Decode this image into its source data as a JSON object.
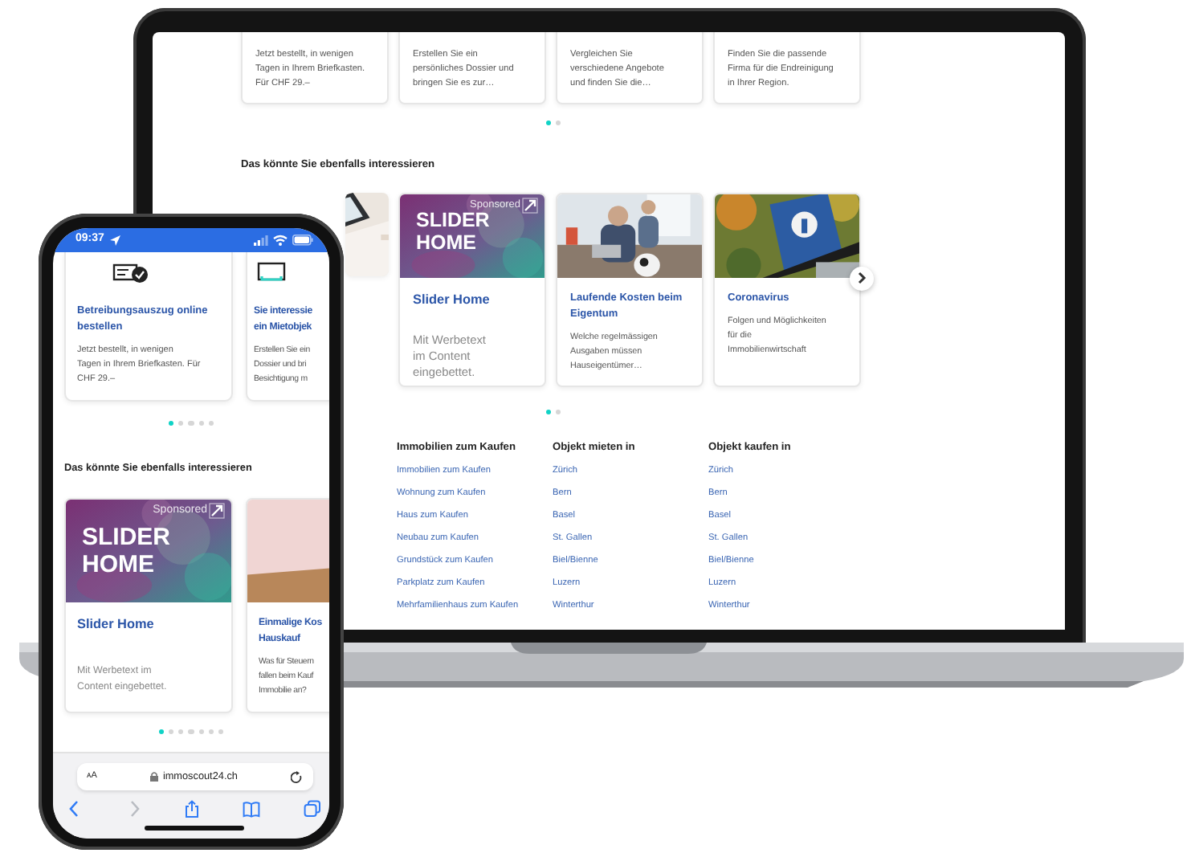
{
  "laptop": {
    "cards": [
      {
        "body": "Jetzt bestellt, in wenigen\nTagen in Ihrem Briefkasten.\nFür CHF 29.–"
      },
      {
        "body": "Erstellen Sie ein\npersönliches Dossier und\nbringen Sie es zur…"
      },
      {
        "body": "Vergleichen Sie\nverschiedene Angebote\nund finden Sie die…"
      },
      {
        "body": "Finden Sie die passende\nFirma für die Endreinigung\nin Ihrer Region."
      }
    ],
    "card_dots": [
      {
        "selected": true
      },
      {
        "selected": false
      }
    ],
    "section_title": "Das könnte Sie ebenfalls interessieren",
    "teasers": [
      {
        "kind": "image_only"
      },
      {
        "kind": "sponsored",
        "badge": "Sponsored",
        "banner": "SLIDER\nHOME",
        "title": "Slider Home",
        "body": "Mit Werbetext\nim Content\neingebettet."
      },
      {
        "kind": "article",
        "title": "Laufende Kosten beim\nEigentum",
        "body": "Welche regelmässigen\nAusgaben müssen\nHauseigentümer…"
      },
      {
        "kind": "article",
        "title": "Coronavirus",
        "body": "Folgen und Möglichkeiten\nfür die\nImmobilienwirtschaft"
      }
    ],
    "teaser_dots": [
      {
        "selected": true
      },
      {
        "selected": false
      }
    ],
    "link_columns": [
      {
        "heading": "Immobilien zum Kaufen",
        "links": [
          "Immobilien zum Kaufen",
          "Wohnung zum Kaufen",
          "Haus zum Kaufen",
          "Neubau zum Kaufen",
          "Grundstück zum Kaufen",
          "Parkplatz zum Kaufen",
          "Mehrfamilienhaus zum Kaufen"
        ]
      },
      {
        "heading": "Objekt mieten in",
        "links": [
          "Zürich",
          "Bern",
          "Basel",
          "St. Gallen",
          "Biel/Bienne",
          "Luzern",
          "Winterthur"
        ]
      },
      {
        "heading": "Objekt kaufen in",
        "links": [
          "Zürich",
          "Bern",
          "Basel",
          "St. Gallen",
          "Biel/Bienne",
          "Luzern",
          "Winterthur"
        ]
      }
    ]
  },
  "phone": {
    "time": "09:37",
    "cards": [
      {
        "title": "Betreibungsauszug online\nbestellen",
        "body": "Jetzt bestellt, in wenigen\nTagen in Ihrem Briefkasten. Für\nCHF 29.–"
      },
      {
        "title": "Sie interessie\nein Mietobjek",
        "body": "Erstellen Sie ein\nDossier und bri\nBesichtigung m"
      }
    ],
    "card_dots": [
      {
        "selected": true
      },
      {
        "selected": false
      },
      {
        "selected": false
      },
      {
        "selected": false
      },
      {
        "selected": false
      }
    ],
    "section_title": "Das könnte Sie ebenfalls interessieren",
    "teasers": [
      {
        "kind": "sponsored",
        "badge": "Sponsored",
        "banner": "SLIDER\nHOME",
        "title": "Slider Home",
        "body": "Mit Werbetext im\nContent eingebettet."
      },
      {
        "kind": "article",
        "title": "Einmalige Kos\nHauskauf",
        "body": "Was für Steuern\nfallen beim Kauf\nImmobilie an?"
      }
    ],
    "teaser_dots": [
      {
        "selected": true
      },
      {
        "selected": false
      },
      {
        "selected": false
      },
      {
        "selected": false
      },
      {
        "selected": false
      },
      {
        "selected": false
      },
      {
        "selected": false
      }
    ],
    "browser": {
      "text_size": "ᴀA",
      "address": "immoscout24.ch",
      "back_enabled": true,
      "forward_enabled": false
    }
  }
}
